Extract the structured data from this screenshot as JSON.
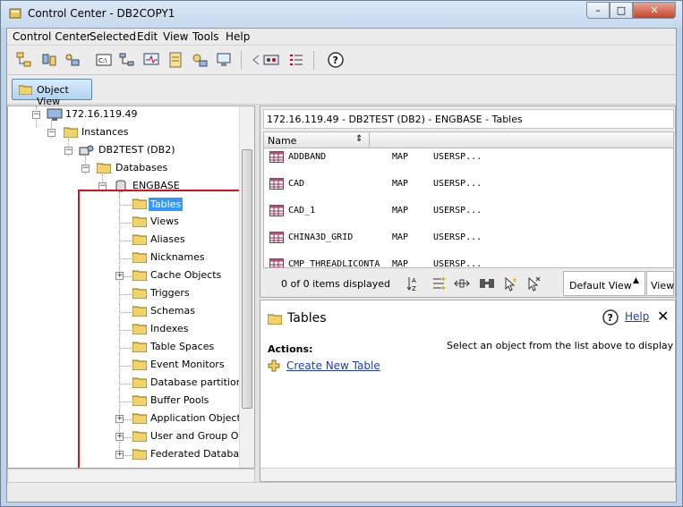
{
  "window": {
    "title": "Control Center - DB2COPY1",
    "minimize": "–",
    "maximize": "□",
    "close": "✕"
  },
  "menu": [
    "Control Center",
    "Selected",
    "Edit",
    "View",
    "Tools",
    "Help"
  ],
  "toolbar_icons": [
    "object-tree-icon",
    "replication-center-icon",
    "satellite-admin-icon",
    "command-editor-icon",
    "task-center-icon",
    "health-center-icon",
    "journal-icon",
    "license-center-icon",
    "configuration-assistant-icon",
    "tools-settings-icon",
    "legend-icon",
    "help-icon"
  ],
  "viewbar": {
    "object_view": "Object View"
  },
  "tree": {
    "host": "172.16.119.49",
    "instances": "Instances",
    "instance": "DB2TEST (DB2)",
    "databases": "Databases",
    "database": "ENGBASE",
    "items": [
      {
        "label": "Tables",
        "selected": true,
        "expander": false
      },
      {
        "label": "Views",
        "expander": false
      },
      {
        "label": "Aliases",
        "expander": false
      },
      {
        "label": "Nicknames",
        "expander": false
      },
      {
        "label": "Cache Objects",
        "expander": true
      },
      {
        "label": "Triggers",
        "expander": false
      },
      {
        "label": "Schemas",
        "expander": false
      },
      {
        "label": "Indexes",
        "expander": false
      },
      {
        "label": "Table Spaces",
        "expander": false
      },
      {
        "label": "Event Monitors",
        "expander": false
      },
      {
        "label": "Database partition g",
        "expander": false
      },
      {
        "label": "Buffer Pools",
        "expander": false
      },
      {
        "label": "Application Objects",
        "expander": true
      },
      {
        "label": "User and Group Obje",
        "expander": true
      },
      {
        "label": "Federated Database",
        "expander": true
      }
    ]
  },
  "contents": {
    "breadcrumb": "172.16.119.49 - DB2TEST (DB2)  - ENGBASE - Tables",
    "column_name": "Name",
    "rows": [
      {
        "name": "ADDBAND",
        "schema": "MAP",
        "tablespace": "USERSP..."
      },
      {
        "name": "CAD",
        "schema": "MAP",
        "tablespace": "USERSP..."
      },
      {
        "name": "CAD_1",
        "schema": "MAP",
        "tablespace": "USERSP..."
      },
      {
        "name": "CHINA3D_GRID",
        "schema": "MAP",
        "tablespace": "USERSP..."
      },
      {
        "name": "CMP_THREADLICONTA",
        "schema": "MAP",
        "tablespace": "USERSP..."
      }
    ],
    "items_displayed": "0 of 0 items displayed",
    "view_select": "Default View",
    "view_button": "View"
  },
  "details": {
    "title": "Tables",
    "help": "Help",
    "actions_label": "Actions:",
    "create_link": "Create New Table",
    "select_message": "Select an object from the list above to display more de"
  },
  "colors": {
    "selection": "#3399ff",
    "highlight_box": "#d1141b",
    "link": "#1f3fb0"
  }
}
